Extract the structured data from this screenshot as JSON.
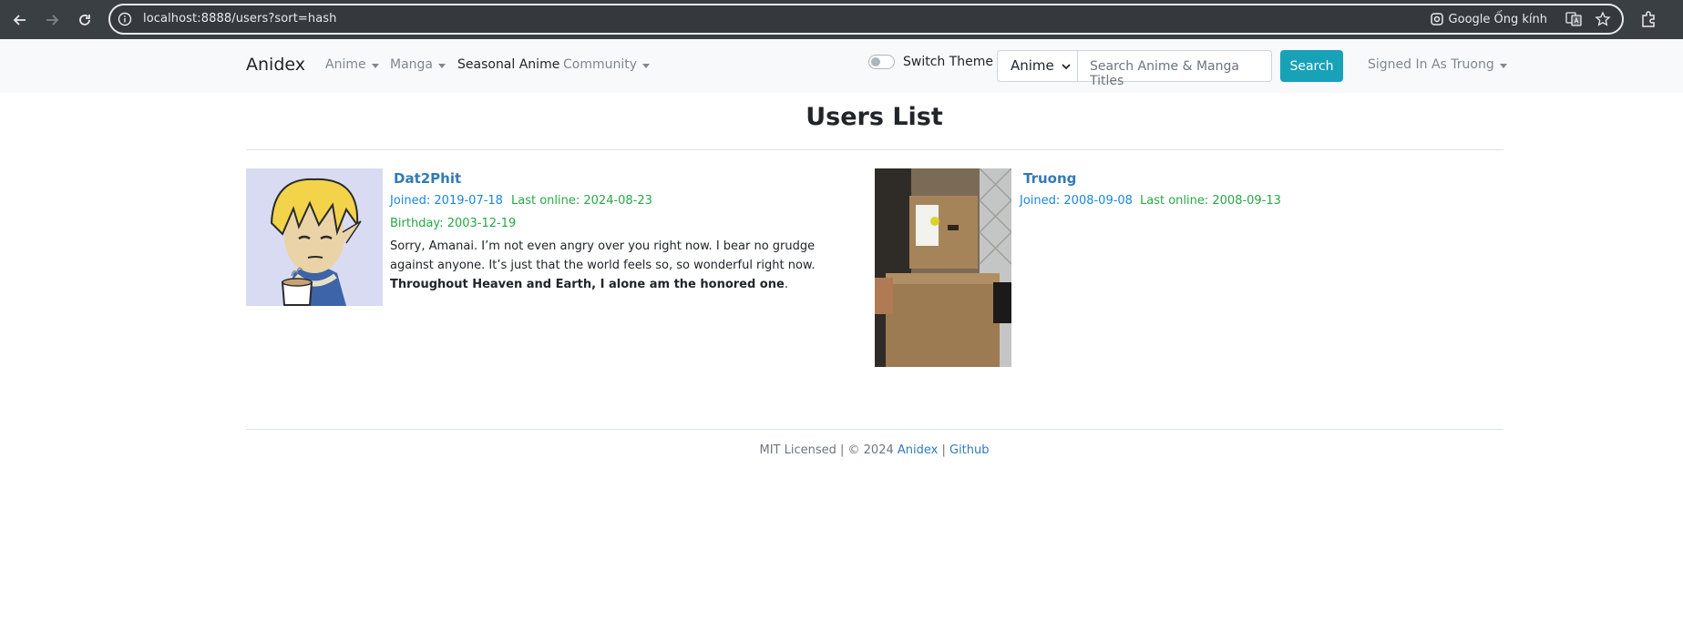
{
  "browser": {
    "url": "localhost:8888/users?sort=hash",
    "lens_label": "Google Ống kính"
  },
  "navbar": {
    "brand": "Anidex",
    "links": [
      {
        "label": "Anime",
        "dropdown": true,
        "active": false
      },
      {
        "label": "Manga",
        "dropdown": true,
        "active": false
      },
      {
        "label": "Seasonal Anime",
        "dropdown": false,
        "active": true
      },
      {
        "label": "Community",
        "dropdown": true,
        "active": false
      }
    ],
    "switch_theme_label": "Switch Theme",
    "search_type": "Anime",
    "search_placeholder": "Search Anime & Manga Titles",
    "search_button": "Search",
    "user_menu": "Signed In As Truong"
  },
  "main": {
    "title": "Users List",
    "users": [
      {
        "name": "Dat2Phit",
        "joined": "Joined: 2019-07-18",
        "last_online": "Last online: 2024-08-23",
        "birthday": "Birthday: 2003-12-19",
        "bio_text": "Sorry, Amanai. I’m not even angry over you right now. I bear no grudge against anyone. It’s just that the world feels so, so wonderful right now. ",
        "bio_bold": "Throughout Heaven and Earth, I alone am the honored one",
        "bio_end": "."
      },
      {
        "name": "Truong",
        "joined": "Joined: 2008-09-08",
        "last_online": "Last online: 2008-09-13"
      }
    ]
  },
  "footer": {
    "license": "MIT Licensed | © 2024 ",
    "link1": "Anidex",
    "sep": " | ",
    "link2": "Github"
  },
  "colors": {
    "search_button": "#17a2b8",
    "link_blue": "#337ab7",
    "online_green": "#28a745"
  }
}
